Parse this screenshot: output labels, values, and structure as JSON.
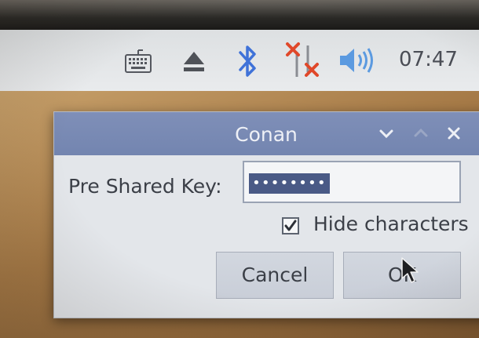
{
  "taskbar": {
    "icons": [
      {
        "name": "keyboard-icon"
      },
      {
        "name": "eject-icon"
      },
      {
        "name": "bluetooth-icon",
        "color": "#3f72d8"
      },
      {
        "name": "network-disconnected-icon",
        "color": "#e0482a"
      },
      {
        "name": "volume-icon",
        "color": "#5b9ae0"
      }
    ],
    "clock": "07:47"
  },
  "dialog": {
    "title": "Conan",
    "title_buttons": [
      "chevron-down-icon",
      "chevron-up-icon",
      "close-icon"
    ],
    "psk_label": "Pre Shared Key:",
    "psk_value": "••••••••",
    "hide_characters_label": "Hide characters",
    "hide_characters_checked": true,
    "cancel_label": "Cancel",
    "ok_label": "OK"
  },
  "colors": {
    "titlebar": "#7a8bb5",
    "dialog_bg": "#e3e6ea",
    "selection": "#4a5a86"
  }
}
